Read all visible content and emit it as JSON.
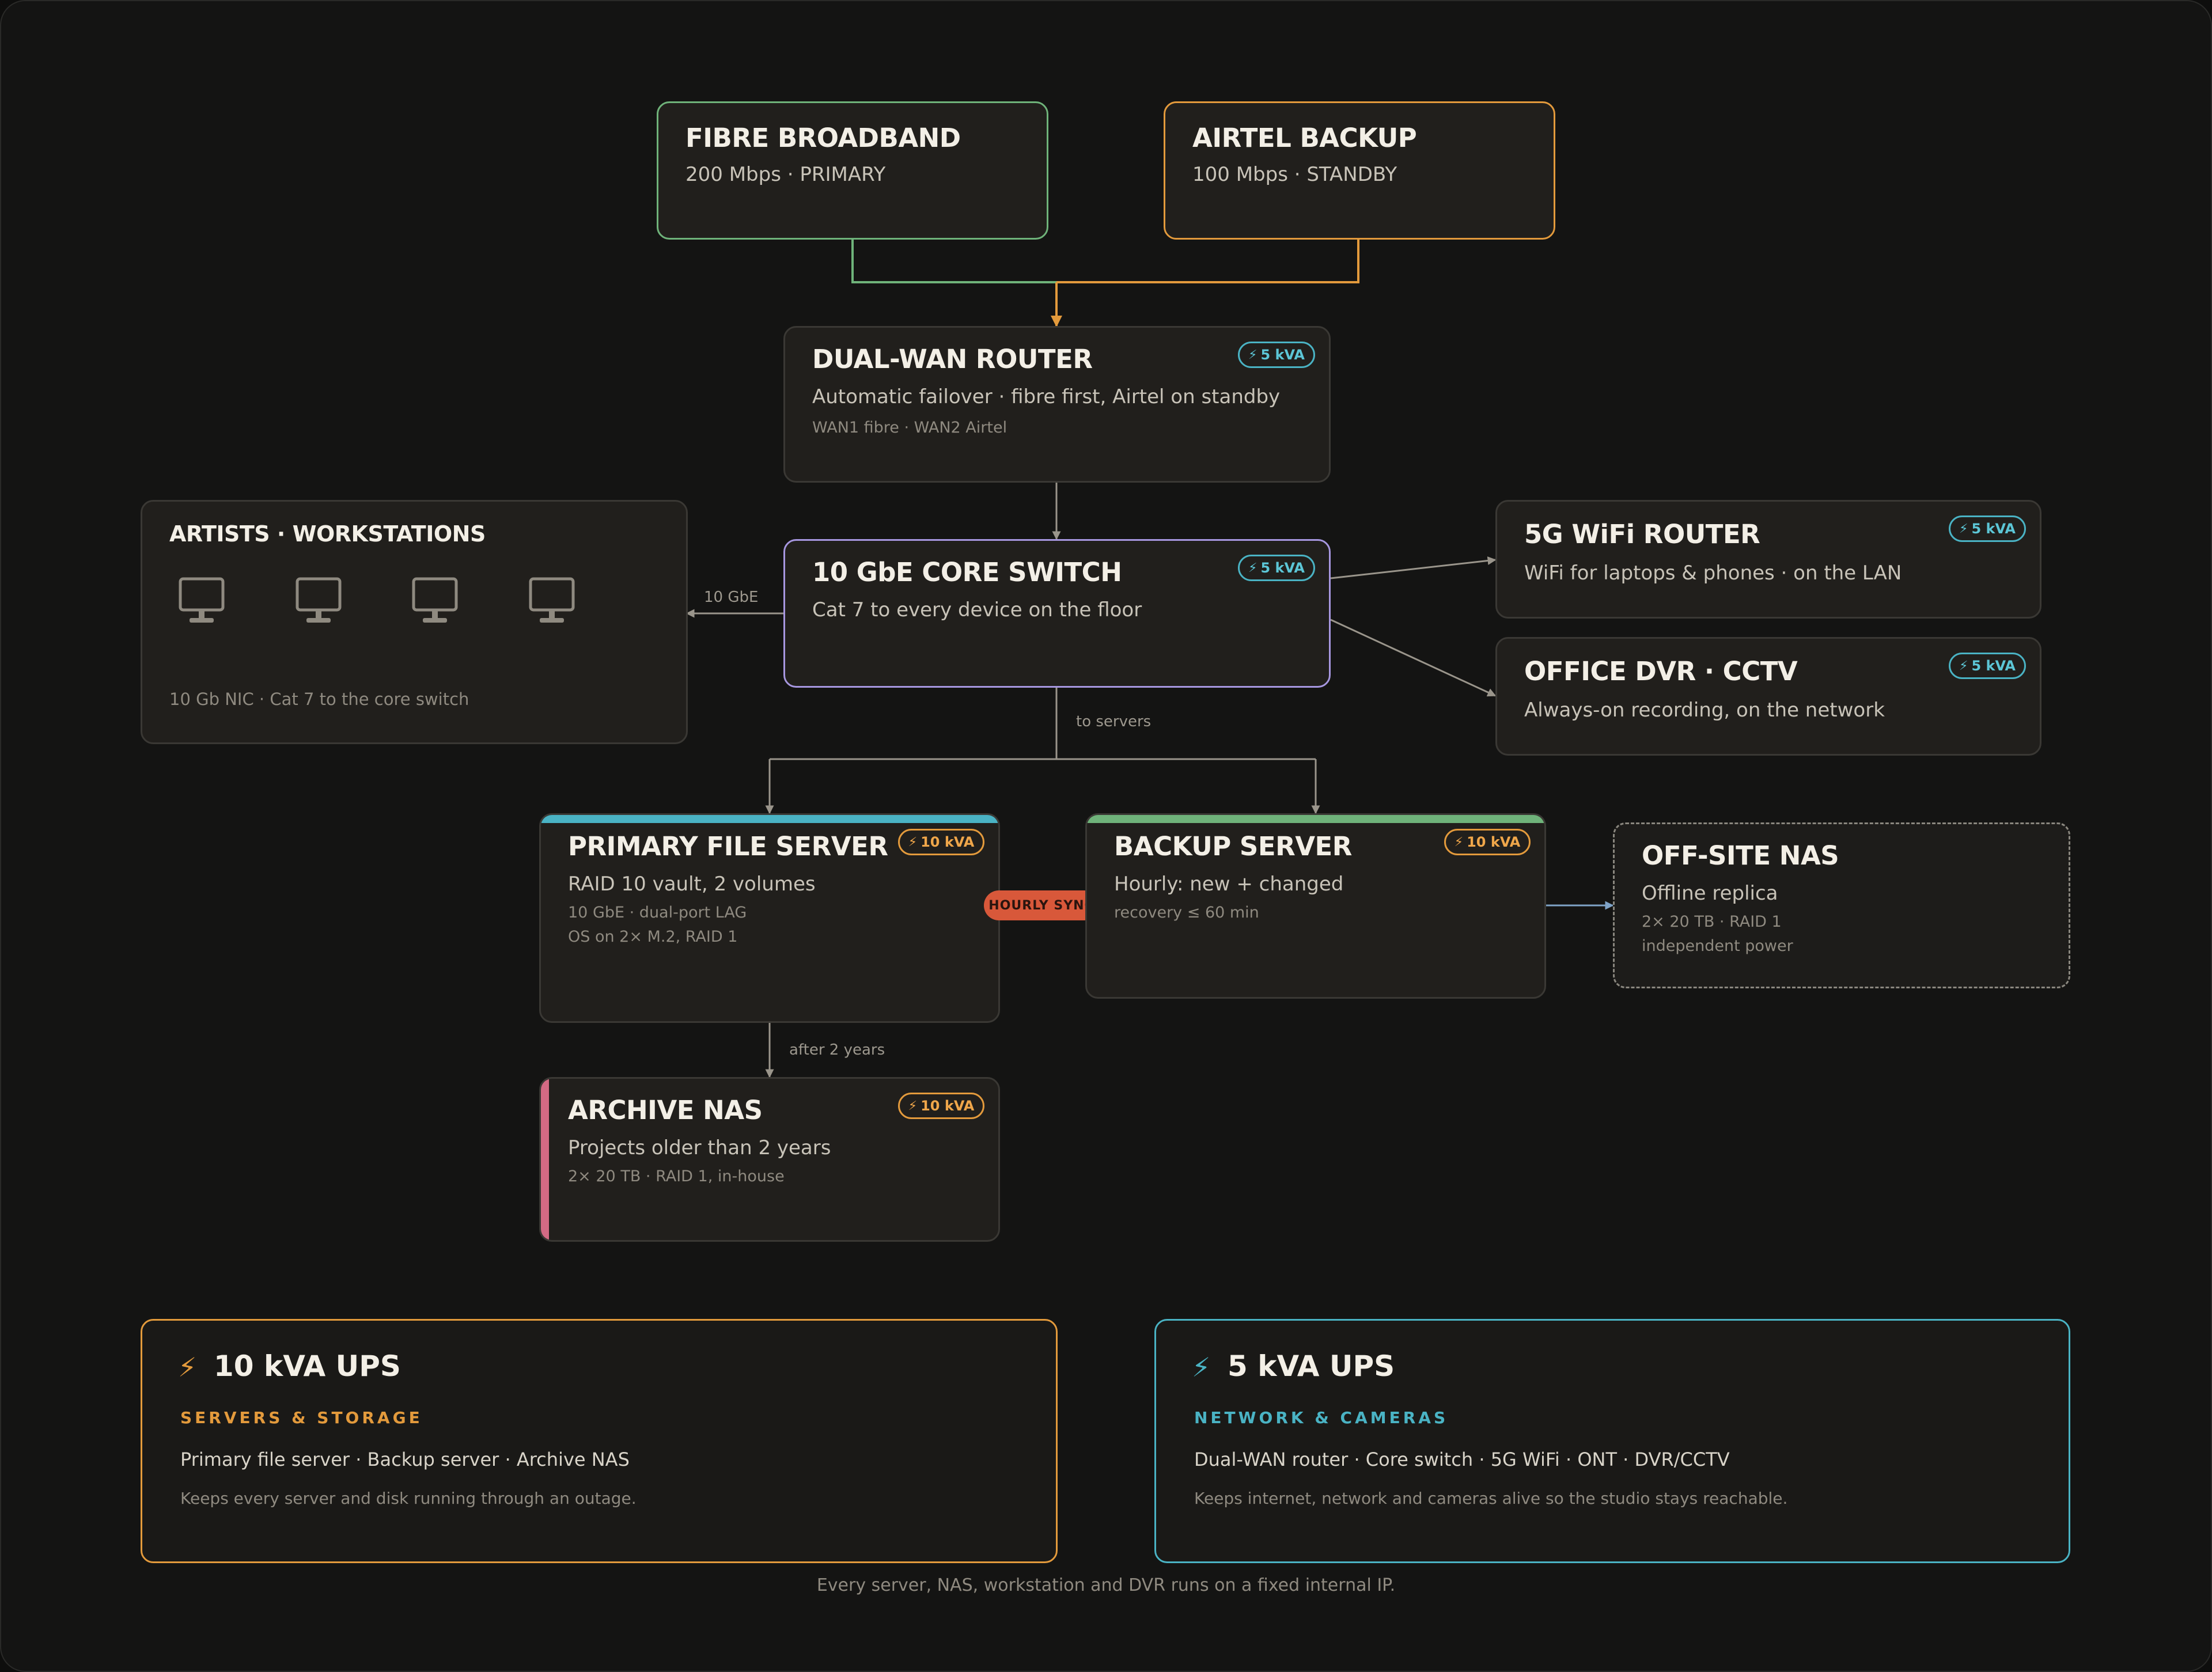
{
  "colors": {
    "background": "#141413",
    "card": "#211f1c",
    "fibre": "#6fb37a",
    "airtel": "#e39a3c",
    "switch": "#a797e0",
    "cyan": "#4ab3c4",
    "orange": "#e39a3c",
    "primary_bar": "#4ab3c4",
    "backup_bar": "#6fb37a",
    "archive_bar": "#d36a84",
    "sync": "#d8583a"
  },
  "nodes": {
    "fibre": {
      "title": "FIBRE BROADBAND",
      "sub": "200 Mbps · PRIMARY"
    },
    "airtel": {
      "title": "AIRTEL BACKUP",
      "sub": "100 Mbps · STANDBY"
    },
    "router": {
      "title": "DUAL-WAN ROUTER",
      "sub": "Automatic failover · fibre first, Airtel on standby",
      "meta": "WAN1 fibre · WAN2 Airtel",
      "badge": "5 kVA"
    },
    "switch": {
      "title": "10 GbE CORE SWITCH",
      "sub": "Cat 7 to every device on the floor",
      "badge": "5 kVA"
    },
    "artists": {
      "title": "ARTISTS · WORKSTATIONS",
      "meta": "10 Gb NIC · Cat 7 to the core switch",
      "icon": "monitor-icon"
    },
    "wifi": {
      "title": "5G WiFi ROUTER",
      "sub": "WiFi for laptops & phones · on the LAN",
      "badge": "5 kVA"
    },
    "dvr": {
      "title": "OFFICE DVR · CCTV",
      "sub": "Always-on recording, on the network",
      "badge": "5 kVA"
    },
    "primary": {
      "title": "PRIMARY FILE SERVER",
      "sub": "RAID 10 vault, 2 volumes",
      "meta1": "10 GbE · dual-port LAG",
      "meta2": "OS on 2× M.2, RAID 1",
      "badge": "10 kVA"
    },
    "backup": {
      "title": "BACKUP SERVER",
      "sub": "Hourly: new + changed",
      "meta": "recovery ≤ 60 min",
      "badge": "10 kVA"
    },
    "offsite": {
      "title": "OFF-SITE NAS",
      "sub": "Offline replica",
      "meta1": "2× 20 TB · RAID 1",
      "meta2": "independent power"
    },
    "archive": {
      "title": "ARCHIVE NAS",
      "sub": "Projects older than 2 years",
      "meta": "2× 20 TB · RAID 1, in-house",
      "badge": "10 kVA"
    }
  },
  "edges": {
    "artists": "10 GbE",
    "servers": "to servers",
    "archive": "after 2 years",
    "sync": "HOURLY SYNC"
  },
  "ups": {
    "big": {
      "title": "10 kVA UPS",
      "tag": "SERVERS & STORAGE",
      "list": "Primary file server · Backup server · Archive NAS",
      "note": "Keeps every server and disk running through an outage."
    },
    "small": {
      "title": "5 kVA UPS",
      "tag": "NETWORK & CAMERAS",
      "list": "Dual-WAN router · Core switch · 5G WiFi · ONT · DVR/CCTV",
      "note": "Keeps internet, network and cameras alive so the studio stays reachable."
    }
  },
  "footer": "Every server, NAS, workstation and DVR runs on a fixed internal IP.",
  "icons": {
    "bolt": "bolt-icon"
  }
}
